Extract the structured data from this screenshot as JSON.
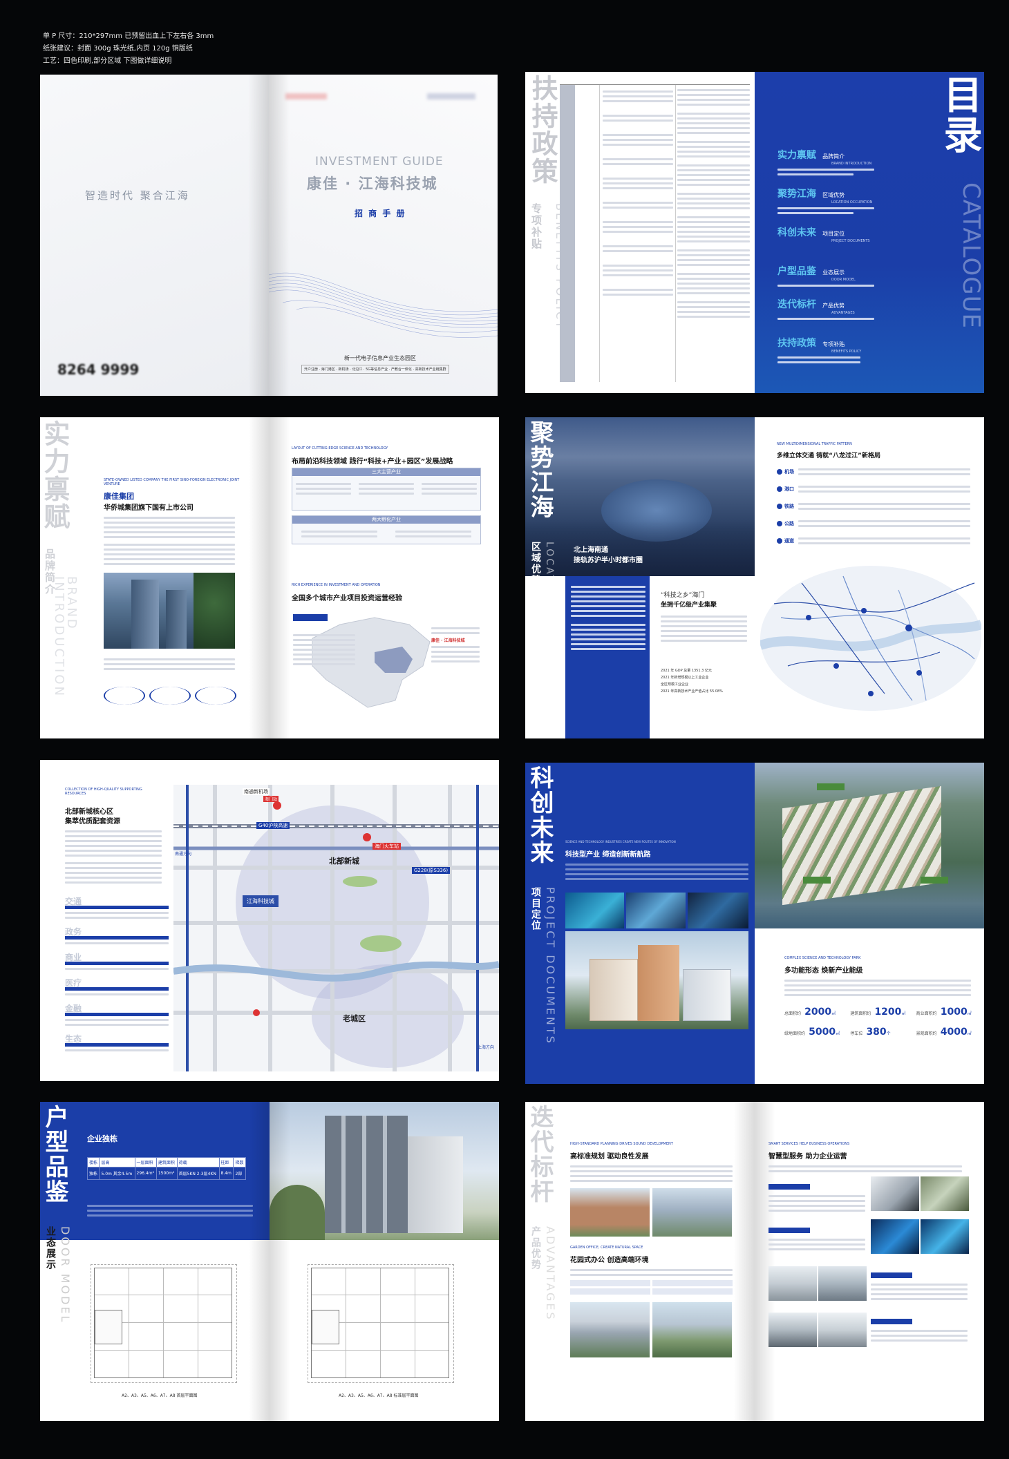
{
  "spec": {
    "size_line": "单 P 尺寸：210*297mm    已预留出血上下左右各 3mm",
    "paper_line": "纸张建议：封面 300g 珠光纸,内页 120g 铜版纸",
    "craft_line": "工艺：四色印刷,部分区域 下图做详细说明"
  },
  "cover": {
    "slogan": "智造时代    聚合江海",
    "title_en": "INVESTMENT GUIDE",
    "title_cn": "康佳 · 江海科技城",
    "subtitle": "招 商 手 册",
    "phone": "8264 9999",
    "park_line": "新一代电子信息产业生态园区",
    "footer": "开户注册 · 海门港区 · 新机场 · 北沿江 · 5G等信息产业 · 产教合一体化 · 高新技术产业链集群"
  },
  "policy": {
    "vertical_cn": "扶持政策",
    "vertical_sub": "专项补贴",
    "vertical_en": "BENEFITS POLICY"
  },
  "catalogue": {
    "title_cn": "目录",
    "title_en": "CATALOGUE",
    "items": [
      {
        "cn": "实力禀赋",
        "sub": "品牌简介",
        "en": "BRAND INTRODUCTION"
      },
      {
        "cn": "聚势江海",
        "sub": "区域优势",
        "en": "LOCATION OCCUPATION"
      },
      {
        "cn": "科创未来",
        "sub": "项目定位",
        "en": "PROJECT DOCUMENTS"
      },
      {
        "cn": "户型品鉴",
        "sub": "业态展示",
        "en": "DOOR MODEL"
      },
      {
        "cn": "迭代标杆",
        "sub": "产品优势",
        "en": "ADVANTAGES"
      },
      {
        "cn": "扶持政策",
        "sub": "专项补贴",
        "en": "BENEFITS POLICY"
      }
    ]
  },
  "brand": {
    "vertical_cn": "实力禀赋",
    "vertical_sub": "品牌简介",
    "vertical_en": "BRAND INTRODUCTION",
    "label_en": "STATE-OWNED LISTED COMPANY THE FIRST SINO-FOREIGN ELECTRONIC JOINT VENTURE",
    "company": "康佳集团",
    "company_sub": "华侨城集团旗下国有上市公司",
    "strategy_en": "LAYOUT OF CUTTING-EDGE SCIENCE AND TECHNOLOGY",
    "strategy": "布局前沿科技领域  践行“科技+产业+园区”发展战略",
    "box1": "三大主营产业",
    "box2": "两大孵化产业",
    "exp_en": "RICH EXPERIENCE IN INVESTMENT AND OPERATION",
    "exp": "全国多个城市产业项目投资运营经验",
    "highlight": "康佳 · 江海科技城"
  },
  "location": {
    "vertical_cn": "聚势江海",
    "vertical_sub": "区域优势",
    "vertical_en": "LOCATION OCCUPATION",
    "photo_caption1": "北上海南通",
    "photo_caption2": "接轨苏沪半小时都市圈",
    "sub1": "“科技之乡”海门",
    "sub2": "坐拥千亿级产业集聚",
    "traffic_en": "NEW MULTIDIMENSIONAL TRAFFIC PATTERN",
    "traffic": "多维立体交通  铸就“八龙过江”新格局",
    "modes": [
      "机场",
      "港口",
      "铁路",
      "公路",
      "通道"
    ],
    "stats": [
      "2021 年 GDP 总量 1351.3 亿元",
      "2021 年新增规模以上工业企业",
      "全区规模工业企业",
      "2021 年高新技术产业产值占比 55.08%"
    ]
  },
  "resources": {
    "label_en": "COLLECTION OF HIGH-QUALITY SUPPORTING RESOURCES",
    "title1": "北部新城核心区",
    "title2": "集萃优质配套资源",
    "cats": [
      "交通",
      "政务",
      "商业",
      "医疗",
      "金融",
      "生态"
    ],
    "map_labels": {
      "airport": "南通新机场",
      "station": "海门站",
      "hs": "海门火车站",
      "north": "北部新城",
      "old": "老城区",
      "project": "江海科技城",
      "g40": "G40沪陕高速",
      "g228": "G228(原S336)",
      "nantong": "南通方向",
      "shanghai": "上海方向"
    }
  },
  "project": {
    "vertical_cn": "科创未来",
    "vertical_sub": "项目定位",
    "vertical_en": "PROJECT DOCUMENTS",
    "label_en": "SCIENCE AND TECHNOLOGY INDUSTRIES CREATE NEW ROUTES OF INNOVATION",
    "title": "科技型产业  缔造创新新航路",
    "park_en": "COMPLEX SCIENCE AND TECHNOLOGY PARK",
    "park": "多功能形态  焕新产业能级",
    "stat_labels": [
      "总面积约",
      "建筑面积约",
      "商业面积约",
      "绿地面积约",
      "停车位",
      "景观面积约"
    ],
    "stat_values": [
      "2000",
      "1200",
      "1000",
      "5000",
      "380",
      "4000"
    ]
  },
  "models": {
    "vertical_cn": "户型品鉴",
    "vertical_sub": "业态展示",
    "vertical_en": "DOOR MODEL",
    "title": "企业独栋",
    "table_head": [
      "楼栋",
      "层高",
      "一层面积",
      "建筑面积",
      "荷载",
      "柱距",
      "梯数"
    ],
    "table_row": [
      "独栋",
      "5.0m 其余4.5m",
      "296.4m²",
      "1500m²",
      "首层5KN 2-3层4KN",
      "8.4m",
      "2部"
    ],
    "plan_left": "A2、A3、A5、A6、A7、A8 首层平面图",
    "plan_right": "A2、A3、A5、A6、A7、A8 标准层平面图"
  },
  "advantages": {
    "vertical_cn": "迭代标杆",
    "vertical_sub": "产品优势",
    "vertical_en": "ADVANTAGES",
    "s1_en": "HIGH-STANDARD PLANNING DRIVES SOUND DEVELOPMENT",
    "s1": "高标准规划  驱动良性发展",
    "s2_en": "GARDEN OFFICE, CREATE NATURAL SPACE",
    "s2": "花园式办公  创造高端环境",
    "s3_en": "SMART SERVICES HELP BUSINESS OPERATIONS",
    "s3": "智慧型服务  助力企业运营"
  }
}
